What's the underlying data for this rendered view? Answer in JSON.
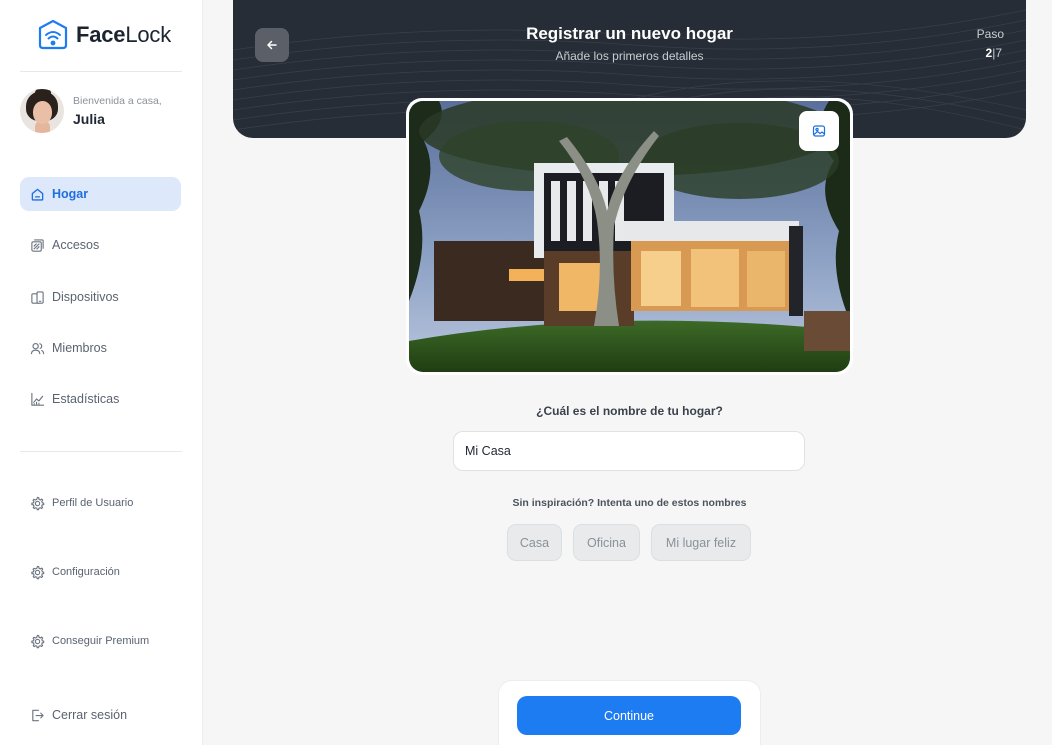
{
  "brand": {
    "name_bold": "Face",
    "name_light": "Lock"
  },
  "user": {
    "greeting": "Bienvenida a casa,",
    "name": "Julia"
  },
  "nav": {
    "main": [
      {
        "label": "Hogar",
        "icon": "home-icon",
        "active": true
      },
      {
        "label": "Accesos",
        "icon": "access-icon",
        "active": false
      },
      {
        "label": "Dispositivos",
        "icon": "devices-icon",
        "active": false
      },
      {
        "label": "Miembros",
        "icon": "members-icon",
        "active": false
      },
      {
        "label": "Estadísticas",
        "icon": "stats-icon",
        "active": false
      }
    ],
    "secondary": [
      {
        "label": "Perfil de Usuario",
        "icon": "gear-icon"
      },
      {
        "label": "Configuración",
        "icon": "gear-icon"
      },
      {
        "label": "Conseguir Premium",
        "icon": "gear-icon"
      }
    ],
    "logout": {
      "label": "Cerrar sesión",
      "icon": "logout-icon"
    }
  },
  "header": {
    "title": "Registrar un nuevo hogar",
    "subtitle": "Añade los primeros detalles",
    "step_label": "Paso",
    "step_current": "2",
    "step_separator": "|",
    "step_total": "7"
  },
  "form": {
    "question": "¿Cuál es el nombre de tu hogar?",
    "name_value": "Mi Casa",
    "hint": "Sin inspiración? Intenta uno de estos nombres",
    "suggestions": [
      "Casa",
      "Oficina",
      "Mi lugar feliz"
    ]
  },
  "footer": {
    "continue_label": "Continue"
  },
  "colors": {
    "accent": "#1d7cf2",
    "active_nav_bg": "#dde9fb",
    "header_bg": "#272d37",
    "page_bg": "#f6f6f6"
  }
}
